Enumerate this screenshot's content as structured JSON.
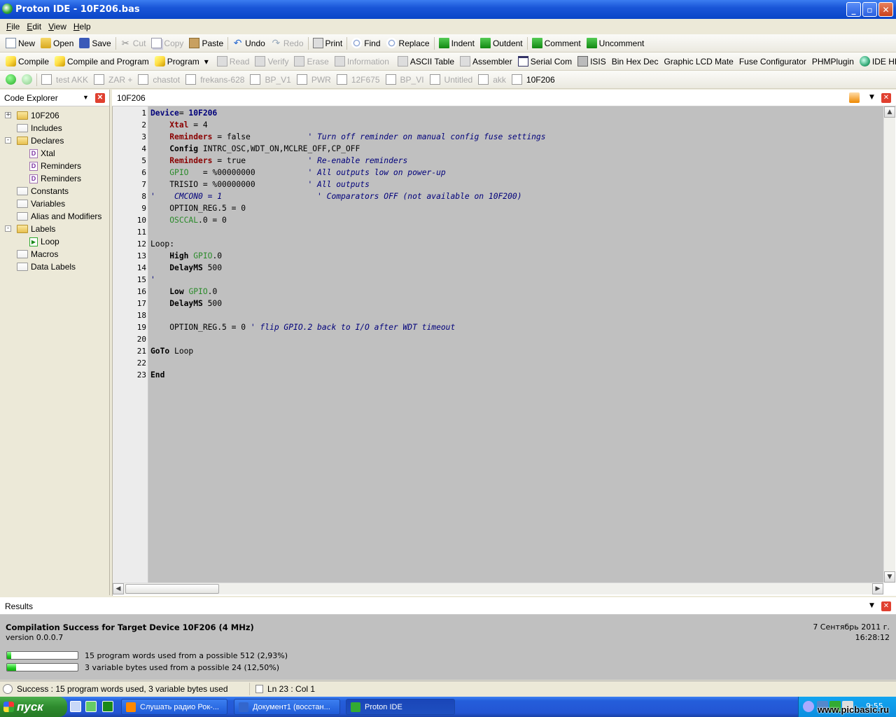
{
  "window": {
    "title": "Proton IDE - 10F206.bas"
  },
  "menu": [
    "File",
    "Edit",
    "View",
    "Help"
  ],
  "toolbar1": [
    {
      "label": "New",
      "icon": "new-file-icon",
      "cls": "ic-doc",
      "enabled": true
    },
    {
      "label": "Open",
      "icon": "open-folder-icon",
      "cls": "ic-open",
      "enabled": true
    },
    {
      "label": "Save",
      "icon": "save-disk-icon",
      "cls": "ic-save",
      "enabled": true
    },
    {
      "sep": true
    },
    {
      "label": "Cut",
      "icon": "scissors-icon",
      "cls": "ic-cut",
      "enabled": false
    },
    {
      "label": "Copy",
      "icon": "copy-icon",
      "cls": "ic-copy",
      "enabled": false
    },
    {
      "label": "Paste",
      "icon": "paste-icon",
      "cls": "ic-paste",
      "enabled": true
    },
    {
      "sep": true
    },
    {
      "label": "Undo",
      "icon": "undo-arrow-icon",
      "cls": "ic-undo",
      "enabled": true
    },
    {
      "label": "Redo",
      "icon": "redo-arrow-icon",
      "cls": "ic-redo",
      "enabled": false
    },
    {
      "sep": true
    },
    {
      "label": "Print",
      "icon": "printer-icon",
      "cls": "ic-print",
      "enabled": true
    },
    {
      "sep": true
    },
    {
      "label": "Find",
      "icon": "find-magnifier-icon",
      "cls": "ic-find",
      "enabled": true
    },
    {
      "label": "Replace",
      "icon": "replace-icon",
      "cls": "ic-find",
      "enabled": true
    },
    {
      "sep": true
    },
    {
      "label": "Indent",
      "icon": "indent-icon",
      "cls": "ic-green",
      "enabled": true
    },
    {
      "label": "Outdent",
      "icon": "outdent-icon",
      "cls": "ic-green",
      "enabled": true
    },
    {
      "sep": true
    },
    {
      "label": "Comment",
      "icon": "comment-icon",
      "cls": "ic-green",
      "enabled": true
    },
    {
      "label": "Uncomment",
      "icon": "uncomment-icon",
      "cls": "ic-green",
      "enabled": true
    }
  ],
  "toolbar2": [
    {
      "label": "Compile",
      "icon": "compile-bolt-icon",
      "cls": "ic-bolt",
      "enabled": true
    },
    {
      "label": "Compile and Program",
      "icon": "compile-program-icon",
      "cls": "ic-bolt",
      "enabled": true
    },
    {
      "label": "Program",
      "icon": "program-icon",
      "cls": "ic-bolt",
      "enabled": true,
      "dropdown": true
    },
    {
      "sep": true
    },
    {
      "label": "Read",
      "icon": "read-chip-icon",
      "cls": "ic-grey",
      "enabled": false
    },
    {
      "label": "Verify",
      "icon": "verify-icon",
      "cls": "ic-grey",
      "enabled": false
    },
    {
      "label": "Erase",
      "icon": "erase-icon",
      "cls": "ic-grey",
      "enabled": false
    },
    {
      "label": "Information",
      "icon": "information-icon",
      "cls": "ic-grey",
      "enabled": false
    },
    {
      "sep": true
    },
    {
      "label": "ASCII Table",
      "icon": "ascii-table-icon",
      "cls": "ic-grey",
      "enabled": true
    },
    {
      "label": "Assembler",
      "icon": "assembler-icon",
      "cls": "ic-grey",
      "enabled": true
    },
    {
      "label": "Serial Com",
      "icon": "serial-com-icon",
      "cls": "ic-win",
      "enabled": true
    },
    {
      "label": "ISIS",
      "icon": "isis-icon",
      "cls": "ic-chip",
      "enabled": true
    },
    {
      "label": "Bin Hex Dec",
      "icon": "",
      "cls": "",
      "enabled": true
    },
    {
      "label": "Graphic LCD Mate",
      "icon": "",
      "cls": "",
      "enabled": true
    },
    {
      "label": "Fuse Configurator",
      "icon": "",
      "cls": "",
      "enabled": true
    },
    {
      "label": "PHMPlugin",
      "icon": "",
      "cls": "",
      "enabled": true
    },
    {
      "label": "IDE HEX View...",
      "icon": "hex-view-globe-icon",
      "cls": "ic-globe",
      "enabled": true
    }
  ],
  "filetabs": [
    {
      "label": "test AKK",
      "active": false
    },
    {
      "label": "ZAR +",
      "active": false
    },
    {
      "label": "chastot",
      "active": false
    },
    {
      "label": "frekans-628",
      "active": false
    },
    {
      "label": "BP_V1",
      "active": false
    },
    {
      "label": "PWR",
      "active": false
    },
    {
      "label": "12F675",
      "active": false
    },
    {
      "label": "BP_VI",
      "active": false
    },
    {
      "label": "Untitled",
      "active": false
    },
    {
      "label": "akk",
      "active": false
    },
    {
      "label": "10F206",
      "active": true
    }
  ],
  "explorer": {
    "title": "Code Explorer",
    "nodes": [
      {
        "label": "10F206",
        "indent": 0,
        "type": "folder-open",
        "expander": "+"
      },
      {
        "label": "Includes",
        "indent": 0,
        "type": "folder"
      },
      {
        "label": "Declares",
        "indent": 0,
        "type": "folder-open",
        "expander": "-"
      },
      {
        "label": "Xtal",
        "indent": 1,
        "type": "declare"
      },
      {
        "label": "Reminders",
        "indent": 1,
        "type": "declare"
      },
      {
        "label": "Reminders",
        "indent": 1,
        "type": "declare"
      },
      {
        "label": "Constants",
        "indent": 0,
        "type": "folder"
      },
      {
        "label": "Variables",
        "indent": 0,
        "type": "folder"
      },
      {
        "label": "Alias and Modifiers",
        "indent": 0,
        "type": "folder"
      },
      {
        "label": "Labels",
        "indent": 0,
        "type": "folder-open",
        "expander": "-"
      },
      {
        "label": "Loop",
        "indent": 1,
        "type": "label"
      },
      {
        "label": "Macros",
        "indent": 0,
        "type": "folder"
      },
      {
        "label": "Data Labels",
        "indent": 0,
        "type": "folder"
      }
    ]
  },
  "editor": {
    "tab": "10F206",
    "lines": [
      [
        [
          "dv",
          "Device"
        ],
        [
          "",
          "= "
        ],
        [
          "dv",
          "10F206"
        ]
      ],
      [
        [
          "",
          "    "
        ],
        [
          "kr",
          "Xtal"
        ],
        [
          "",
          " = 4"
        ]
      ],
      [
        [
          "",
          "    "
        ],
        [
          "kr",
          "Reminders"
        ],
        [
          "",
          " = false            "
        ],
        [
          "cm",
          "' Turn off reminder on manual config fuse settings"
        ]
      ],
      [
        [
          "",
          "    "
        ],
        [
          "kw",
          "Config"
        ],
        [
          "",
          " INTRC_OSC,WDT_ON,MCLRE_OFF,CP_OFF"
        ]
      ],
      [
        [
          "",
          "    "
        ],
        [
          "kr",
          "Reminders"
        ],
        [
          "",
          " = true             "
        ],
        [
          "cm",
          "' Re-enable reminders"
        ]
      ],
      [
        [
          "",
          "    "
        ],
        [
          "gp",
          "GPIO"
        ],
        [
          "",
          "   = %00000000           "
        ],
        [
          "cm",
          "' All outputs low on power-up"
        ]
      ],
      [
        [
          "",
          "    TRISIO = %00000000           "
        ],
        [
          "cm",
          "' All outputs"
        ]
      ],
      [
        [
          "cm",
          "'    CMCON0 = 1                    ' Comparators OFF (not available on 10F200)"
        ]
      ],
      [
        [
          "",
          "    OPTION_REG.5 = 0"
        ]
      ],
      [
        [
          "",
          "    "
        ],
        [
          "gp",
          "OSCCAL"
        ],
        [
          "",
          ".0 = 0"
        ]
      ],
      [
        [
          "",
          ""
        ]
      ],
      [
        [
          "",
          "Loop:"
        ]
      ],
      [
        [
          "",
          "    "
        ],
        [
          "kw",
          "High"
        ],
        [
          "",
          " "
        ],
        [
          "gp",
          "GPIO"
        ],
        [
          "",
          ".0"
        ]
      ],
      [
        [
          "",
          "    "
        ],
        [
          "kw",
          "DelayMS"
        ],
        [
          "",
          " 500"
        ]
      ],
      [
        [
          "cm",
          "'"
        ]
      ],
      [
        [
          "",
          "    "
        ],
        [
          "kw",
          "Low"
        ],
        [
          "",
          " "
        ],
        [
          "gp",
          "GPIO"
        ],
        [
          "",
          ".0"
        ]
      ],
      [
        [
          "",
          "    "
        ],
        [
          "kw",
          "DelayMS"
        ],
        [
          "",
          " 500"
        ]
      ],
      [
        [
          "",
          ""
        ]
      ],
      [
        [
          "",
          "    OPTION_REG.5 = 0 "
        ],
        [
          "cm",
          "' flip GPIO.2 back to I/O after WDT timeout"
        ]
      ],
      [
        [
          "",
          ""
        ]
      ],
      [
        [
          "kw",
          "GoTo"
        ],
        [
          "",
          " Loop"
        ]
      ],
      [
        [
          "",
          ""
        ]
      ],
      [
        [
          "kw",
          "End"
        ]
      ]
    ]
  },
  "results": {
    "title": "Results",
    "headline": "Compilation Success for Target Device 10F206 (4 MHz)",
    "version": "version 0.0.0.7",
    "date": "7 Сентябрь 2011 г.",
    "time": "16:28:12",
    "program_words": "15 program words used from a possible 512 (2,93%)",
    "program_fraction": 0.0293,
    "variable_bytes": "3 variable bytes used from a possible 24 (12,50%)",
    "variable_fraction": 0.125
  },
  "status": {
    "message": "Success : 15 program words used, 3 variable bytes used",
    "position": "Ln 23 : Col 1"
  },
  "taskbar": {
    "start": "пуск",
    "tasks": [
      {
        "label": "Слушать радио Рок-...",
        "active": false
      },
      {
        "label": "Документ1 (восстан...",
        "active": false
      },
      {
        "label": "Proton IDE",
        "active": true
      }
    ],
    "clock": "9:55"
  },
  "watermark": "www.picbasic.ru"
}
